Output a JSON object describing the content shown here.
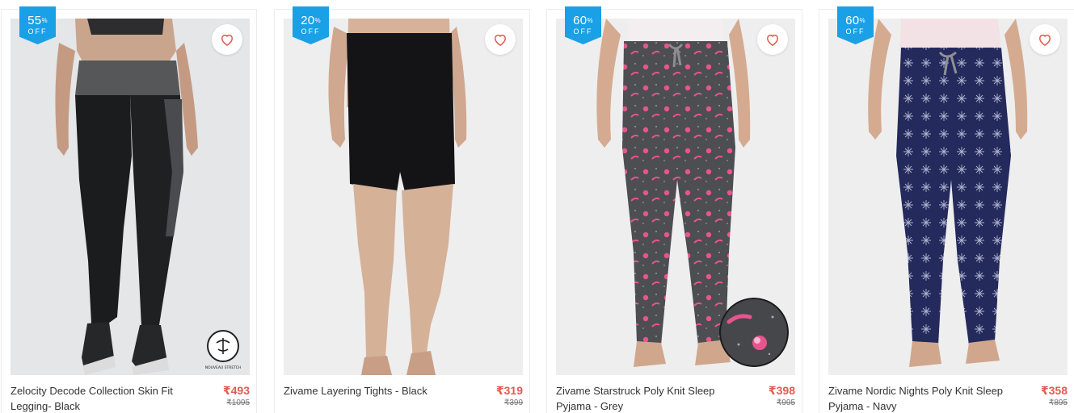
{
  "products": [
    {
      "discount_number": "55",
      "discount_percent_sign": "%",
      "discount_off": "OFF",
      "name": "Zelocity Decode Collection Skin Fit Legging- Black",
      "price": "₹493",
      "mrp": "₹1095",
      "wishlist_icon": "heart-outline-icon",
      "overlay_badge_text": "NOUVEAU STRETCH"
    },
    {
      "discount_number": "20",
      "discount_percent_sign": "%",
      "discount_off": "OFF",
      "name": "Zivame Layering Tights - Black",
      "price": "₹319",
      "mrp": "₹399",
      "wishlist_icon": "heart-outline-icon"
    },
    {
      "discount_number": "60",
      "discount_percent_sign": "%",
      "discount_off": "OFF",
      "name": "Zivame Starstruck Poly Knit Sleep Pyjama - Grey",
      "price": "₹398",
      "mrp": "₹995",
      "wishlist_icon": "heart-outline-icon"
    },
    {
      "discount_number": "60",
      "discount_percent_sign": "%",
      "discount_off": "OFF",
      "name": "Zivame Nordic Nights Poly Knit Sleep Pyjama - Navy",
      "price": "₹358",
      "mrp": "₹895",
      "wishlist_icon": "heart-outline-icon"
    }
  ],
  "colors": {
    "badge_blue": "#1aa0e6",
    "price_red": "#e25a54",
    "heart_red": "#e2574c"
  }
}
